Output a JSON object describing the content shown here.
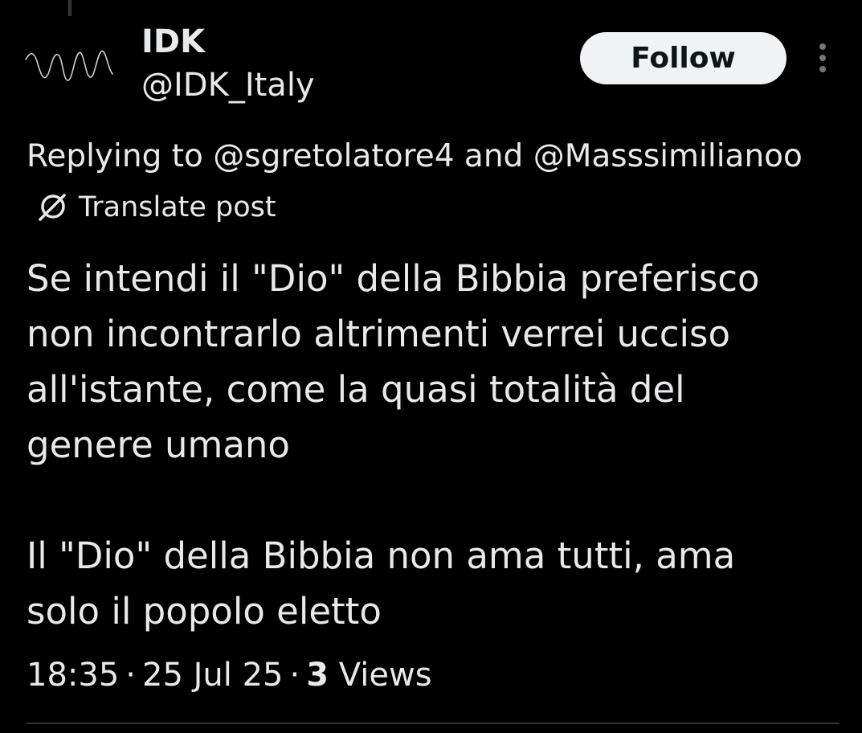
{
  "author": {
    "display_name": "IDK",
    "handle": "@IDK_Italy"
  },
  "follow_label": "Follow",
  "replying_to": "Replying to @sgretolatore4 and @Masssimilianoo",
  "translate_label": "Translate post",
  "post": {
    "text": "Se intendi il \"Dio\" della Bibbia preferisco\nnon incontrarlo altrimenti verrei ucciso\nall'istante, come la quasi totalità del\ngenere umano\n\nIl \"Dio\" della Bibbia non ama tutti, ama\nsolo il popolo eletto"
  },
  "meta": {
    "time": "18:35",
    "date": "25 Jul 25",
    "views_count": "3",
    "views_label": "Views",
    "separator": "·"
  },
  "icons": {
    "avatar": "waveform-avatar",
    "more": "more-vertical-icon",
    "translate": "translate-globe-icon"
  },
  "colors": {
    "background": "#000000",
    "text": "#e7e9ea",
    "follow_bg": "#eff3f4",
    "follow_text": "#0f1419",
    "muted": "#71767b"
  }
}
